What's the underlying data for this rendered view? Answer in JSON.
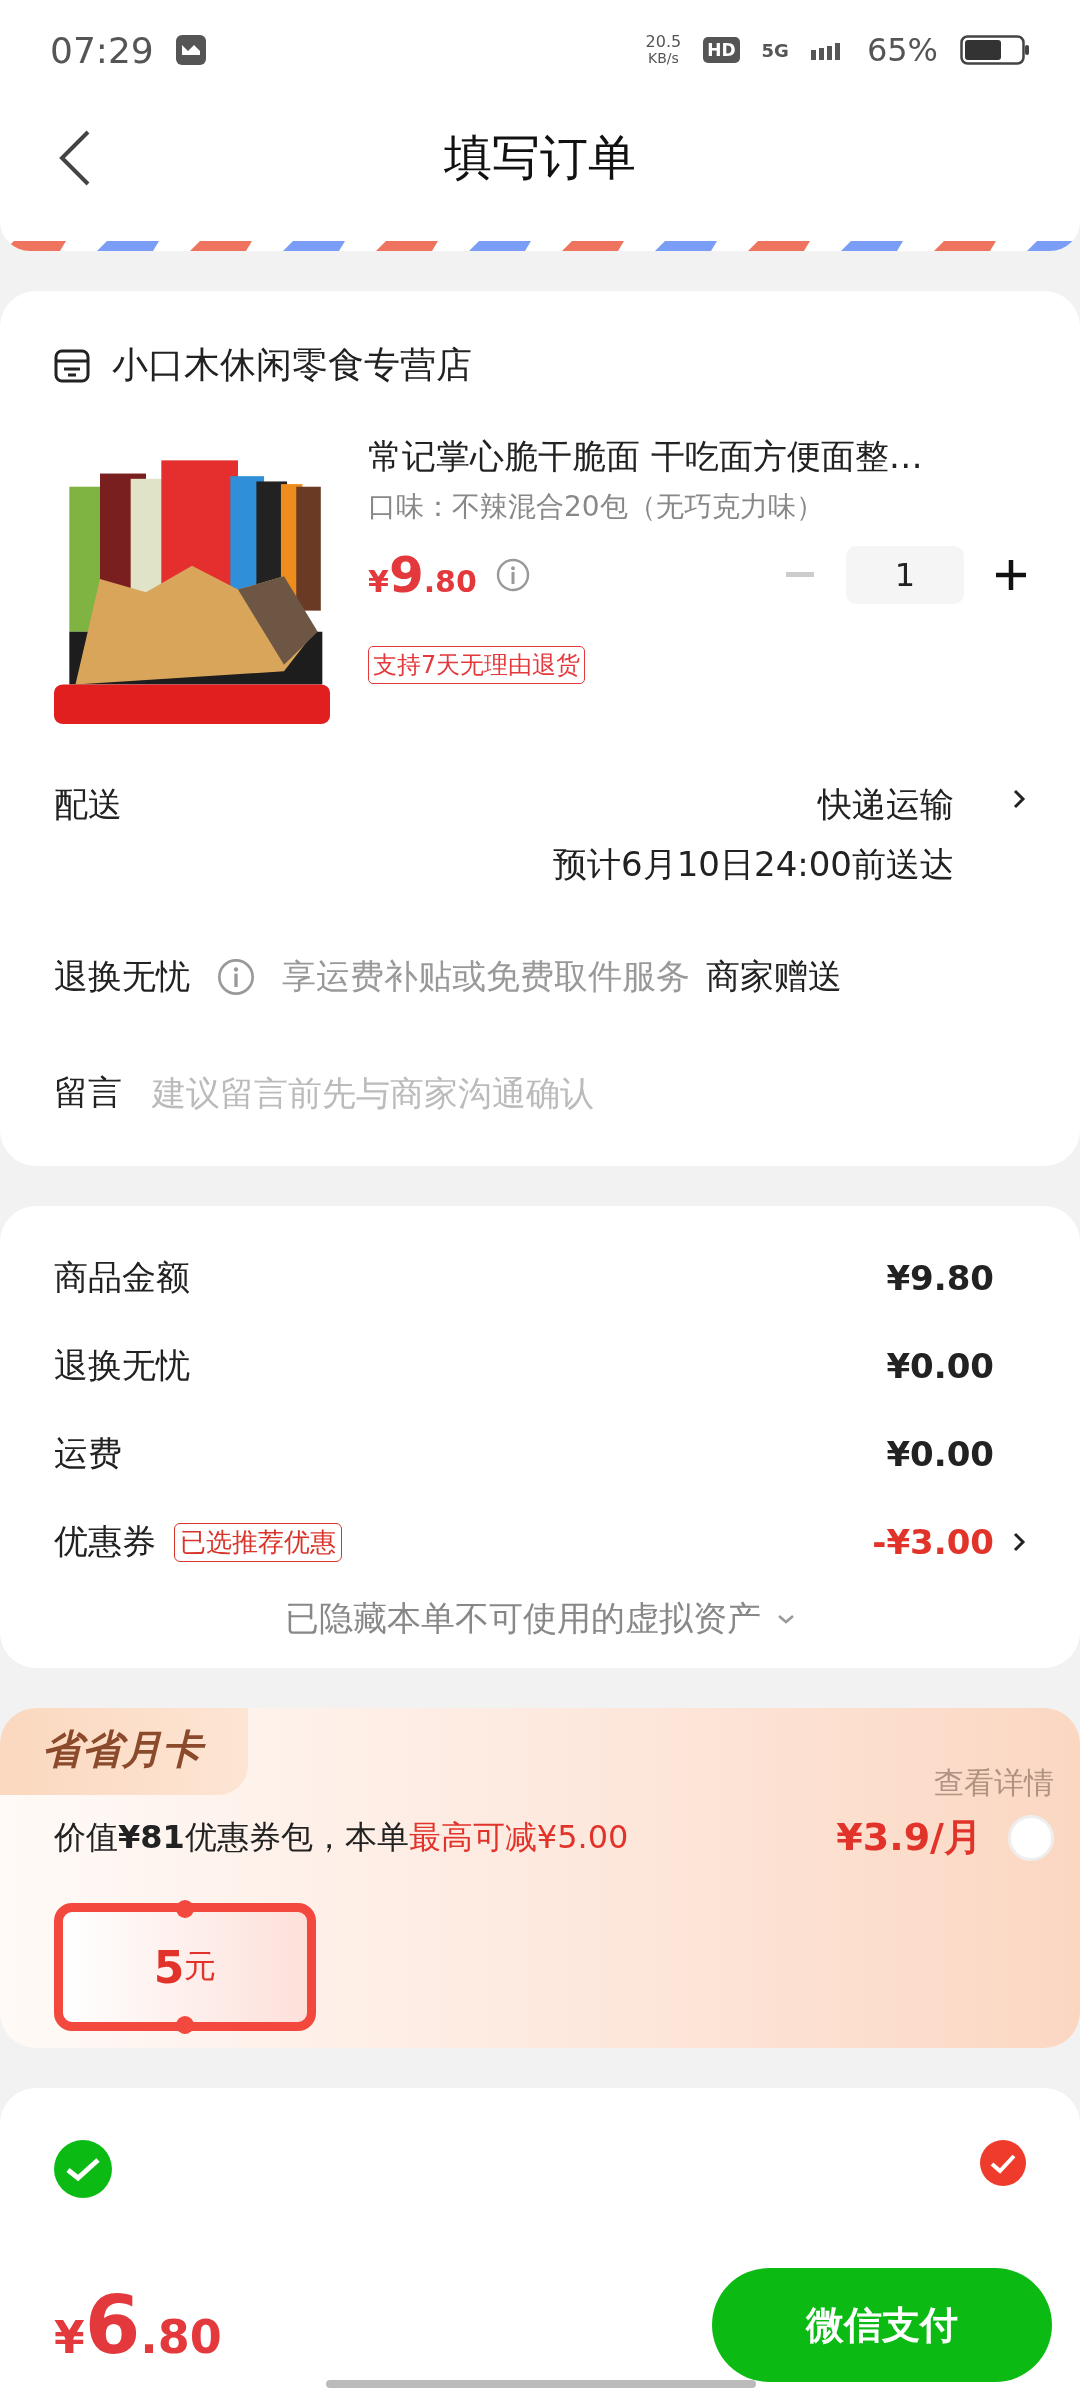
{
  "status_bar": {
    "time": "07:29",
    "speed": "20.5",
    "speed_unit": "KB/s",
    "hd": "HD",
    "network": "5G",
    "battery": "65%"
  },
  "header": {
    "title": "填写订单"
  },
  "shop": {
    "name": "小口木休闲零食专营店"
  },
  "product": {
    "title": "常记掌心脆干脆面 干吃面方便面整…",
    "spec": "口味：不辣混合20包（无巧克力味）",
    "currency": "¥",
    "price_int": "9",
    "price_dec": ".80",
    "quantity": "1",
    "tag": "支持7天无理由退货"
  },
  "delivery": {
    "label": "配送",
    "value": "快递运输",
    "eta": "预计6月10日24:00前送达"
  },
  "returns": {
    "label": "退换无忧",
    "desc": "享运费补贴或免费取件服务",
    "value": "商家赠送"
  },
  "message": {
    "label": "留言",
    "placeholder": "建议留言前先与商家沟通确认"
  },
  "summary": [
    {
      "kind": "plain",
      "label": "商品金额",
      "value": "¥9.80"
    },
    {
      "kind": "plain",
      "label": "退换无忧",
      "value": "¥0.00"
    },
    {
      "kind": "plain",
      "label": "运费",
      "value": "¥0.00"
    },
    {
      "kind": "discount",
      "label": "优惠券",
      "badge": "已选推荐优惠",
      "value": "-¥3.00"
    }
  ],
  "hidden_note": "已隐藏本单不可使用的虚拟资产",
  "month_card": {
    "title": "省省月卡",
    "details": "查看详情",
    "desc": "价值**¥81**优惠券包，本单",
    "highlight": "最高可减¥5.00",
    "price": "¥3.9/月",
    "selected": false,
    "voucher_amount": "5",
    "voucher_unit": "元"
  },
  "payment": {
    "selected": true
  },
  "bottom_bar": {
    "currency": "¥",
    "total_int": "6",
    "total_dec": ".80",
    "pay_button": "微信支付"
  }
}
